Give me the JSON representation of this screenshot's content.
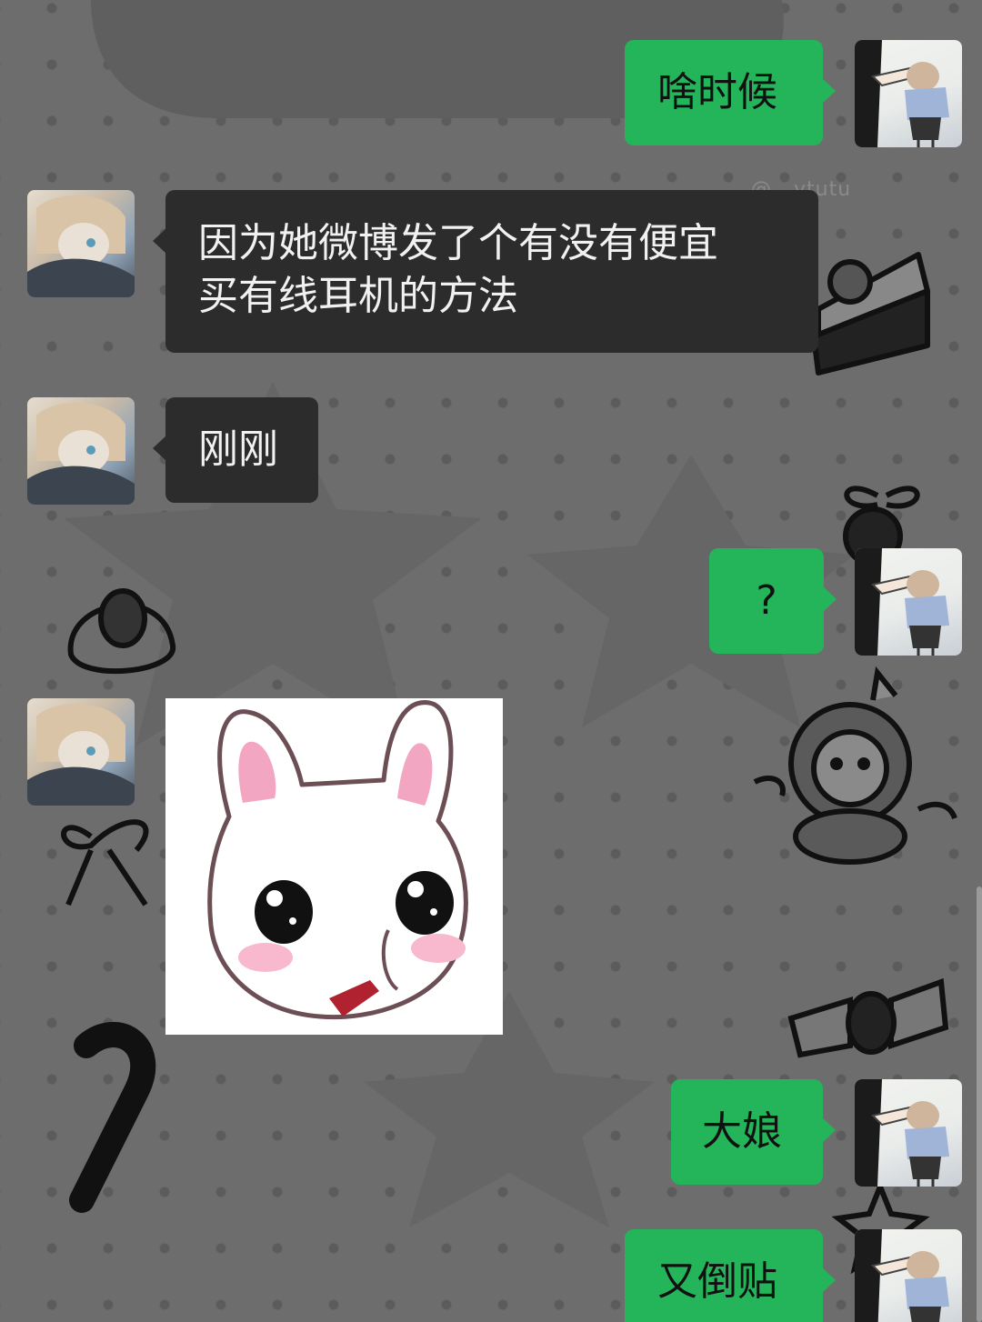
{
  "watermark": "@...ytutu",
  "messages": [
    {
      "direction": "outgoing",
      "text": "啥时候"
    },
    {
      "direction": "incoming",
      "lines": [
        "因为她微博发了个有没有便宜",
        "买有线耳机的方法"
      ]
    },
    {
      "direction": "incoming",
      "text": "刚刚"
    },
    {
      "direction": "outgoing",
      "text": "?"
    },
    {
      "direction": "incoming",
      "type": "sticker",
      "sticker": "white-bunny-sticker"
    },
    {
      "direction": "outgoing",
      "text": "大娘"
    },
    {
      "direction": "outgoing",
      "text": "又倒贴"
    }
  ],
  "colors": {
    "outgoing_bubble": "#24b55a",
    "incoming_bubble": "#2c2c2c",
    "background": "#6d6d6d"
  }
}
